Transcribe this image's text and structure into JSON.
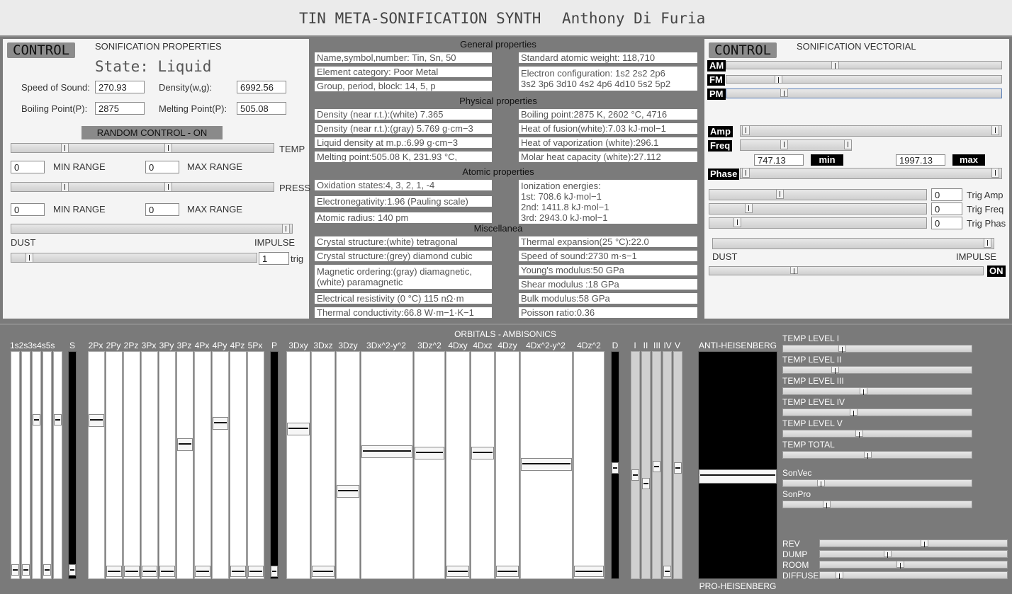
{
  "title": {
    "synth": "TIN META-SONIFICATION SYNTH",
    "author": "Anthony Di Furia"
  },
  "left": {
    "control_label": "CONTROL",
    "heading": "SONIFICATION PROPERTIES",
    "state": "State: Liquid",
    "speed_label": "Speed of Sound:",
    "speed_value": "270.93",
    "density_label": "Density(w,g):",
    "density_value": "6992.56",
    "boiling_label": "Boiling Point(P):",
    "boiling_value": "2875",
    "melting_label": "Melting Point(P):",
    "melting_value": "505.08",
    "random_button": "RANDOM CONTROL - ON",
    "temp_label": "TEMP",
    "press_label": "PRESS",
    "min_range": "MIN RANGE",
    "max_range": "MAX RANGE",
    "temp_min": "0",
    "temp_max": "0",
    "press_min": "0",
    "press_max": "0",
    "dust": "DUST",
    "impulse": "IMPULSE",
    "trig_value": "1",
    "trig_label": "trig"
  },
  "center": {
    "general_title": "General properties",
    "general_left": [
      "Name,symbol,number: Tin, Sn, 50",
      "Element category: Poor Metal",
      "Group, period, block: 14, 5, p"
    ],
    "general_right": [
      "Standard atomic weight: 118,710",
      "Electron configuration: 1s2 2s2 2p6",
      "3s2 3p6 3d10 4s2 4p6 4d10 5s2 5p2"
    ],
    "physical_title": "Physical properties",
    "physical_left": [
      "Density (near r.t.):(white) 7.365",
      "Density (near r.t.):(gray) 5.769 g·cm−3",
      "Liquid density at m.p.:6.99 g·cm−3",
      "Melting point:505.08 K, 231.93 °C,"
    ],
    "physical_right": [
      "Boiling point:2875 K, 2602 °C, 4716",
      "Heat of fusion(white):7.03 kJ·mol−1",
      "Heat of vaporization (white):296.1",
      "Molar heat capacity (white):27.112"
    ],
    "atomic_title": "Atomic properties",
    "atomic_left": [
      "Oxidation states:4, 3, 2, 1, -4",
      "Electronegativity:1.96 (Pauling scale)",
      "Atomic radius: 140 pm"
    ],
    "atomic_right": [
      "Ionization energies:",
      "1st: 708.6 kJ·mol−1",
      "2nd: 1411.8 kJ·mol−1",
      "3rd: 2943.0 kJ·mol−1"
    ],
    "misc_title": "Miscellanea",
    "misc_left": [
      "Crystal structure:(white) tetragonal",
      "Crystal structure:(grey) diamond cubic",
      "Magnetic ordering:(gray) diamagnetic,",
      "(white) paramagnetic",
      "Electrical resistivity (0 °C) 115 nΩ·m",
      "Thermal conductivity:66.8 W·m−1·K−1"
    ],
    "misc_right": [
      "Thermal expansion(25 °C):22.0",
      "Speed of sound:2730 m·s−1",
      "Young's modulus:50 GPa",
      "Shear modulus :18 GPa",
      "Bulk modulus:58 GPa",
      "Poisson ratio:0.36"
    ]
  },
  "right": {
    "control_label": "CONTROL",
    "heading": "SONIFICATION VECTORIAL",
    "am": "AM",
    "fm": "FM",
    "pm": "PM",
    "amp": "Amp",
    "freq": "Freq",
    "phase": "Phase",
    "freq_min_value": "747.13",
    "min": "min",
    "freq_max_value": "1997.13",
    "max": "max",
    "trig_amp_value": "0",
    "trig_amp": "Trig Amp",
    "trig_freq_value": "0",
    "trig_freq": "Trig Freq",
    "trig_phas_value": "0",
    "trig_phas": "Trig Phas",
    "dust": "DUST",
    "impulse": "IMPULSE",
    "on": "ON"
  },
  "bottom": {
    "title": "ORBITALS - AMBISONICS",
    "anti": "ANTI-HEISENBERG",
    "pro": "PRO-HEISENBERG",
    "s_labels": "1s2s3s4s5s",
    "s": "S",
    "p": "P",
    "d": "D",
    "p_orbitals": [
      "2Px",
      "2Py",
      "2Pz",
      "3Px",
      "3Py",
      "3Pz",
      "4Px",
      "4Py",
      "4Pz",
      "5Px"
    ],
    "d_orbitals": [
      "3Dxy",
      "3Dxz",
      "3Dzy",
      "3Dx^2-y^2",
      "3Dz^2",
      "4Dxy",
      "4Dxz",
      "4Dzy",
      "4Dx^2-y^2",
      "4Dz^2"
    ],
    "roman": [
      "I",
      "II",
      "III",
      "IV",
      "V"
    ],
    "levels": [
      "TEMP LEVEL I",
      "TEMP LEVEL II",
      "TEMP LEVEL III",
      "TEMP LEVEL IV",
      "TEMP LEVEL V",
      "TEMP TOTAL",
      "SonVec",
      "SonPro"
    ],
    "fx": [
      "REV",
      "DUMP",
      "ROOM",
      "DIFFUSE"
    ]
  }
}
